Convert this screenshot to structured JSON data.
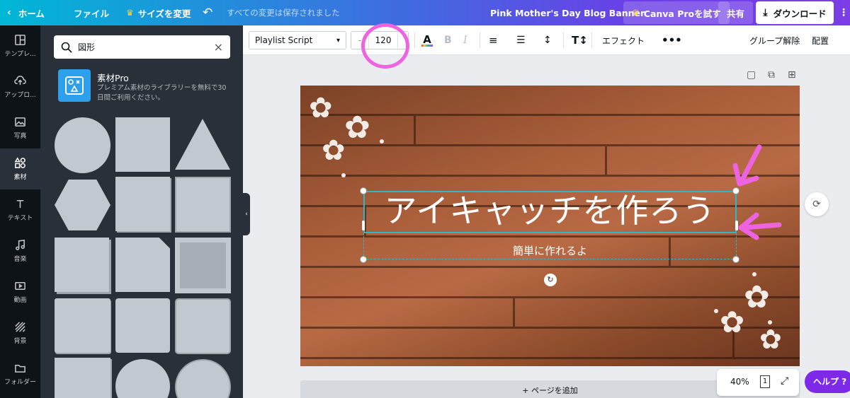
{
  "topbar": {
    "home": "ホーム",
    "file": "ファイル",
    "resize": "サイズを変更",
    "saved": "すべての変更は保存されました",
    "title": "Pink Mother's Day Blog Banner",
    "pro": "Canva Proを試す",
    "share": "共有",
    "download": "ダウンロード"
  },
  "rail": [
    {
      "label": "テンプレ...",
      "icon": "template-icon"
    },
    {
      "label": "アップロ...",
      "icon": "upload-icon"
    },
    {
      "label": "写真",
      "icon": "photo-icon"
    },
    {
      "label": "素材",
      "icon": "elements-icon"
    },
    {
      "label": "テキスト",
      "icon": "text-icon"
    },
    {
      "label": "音楽",
      "icon": "music-icon"
    },
    {
      "label": "動画",
      "icon": "video-icon"
    },
    {
      "label": "背景",
      "icon": "background-icon"
    },
    {
      "label": "フォルダー",
      "icon": "folder-icon"
    }
  ],
  "panel": {
    "search_value": "図形",
    "pro_title": "素材Pro",
    "pro_desc": "プレミアム素材のライブラリーを無料で30日間ご利用ください。"
  },
  "toolbar": {
    "font": "Playlist Script",
    "font_size": "120",
    "bold": "B",
    "italic": "I",
    "effects": "エフェクト",
    "ungroup": "グループ解除",
    "arrange": "配置"
  },
  "design": {
    "headline": "アイキャッチを作ろう",
    "subtitle": "簡単に作れるよ"
  },
  "bottom": {
    "add_page": "+ ページを追加",
    "zoom": "40%",
    "page_count": "1",
    "help": "ヘルプ ?"
  },
  "colors": {
    "annotation": "#ee63e0",
    "selection": "#2fb7c7",
    "brand_purple": "#7d2ae8"
  }
}
